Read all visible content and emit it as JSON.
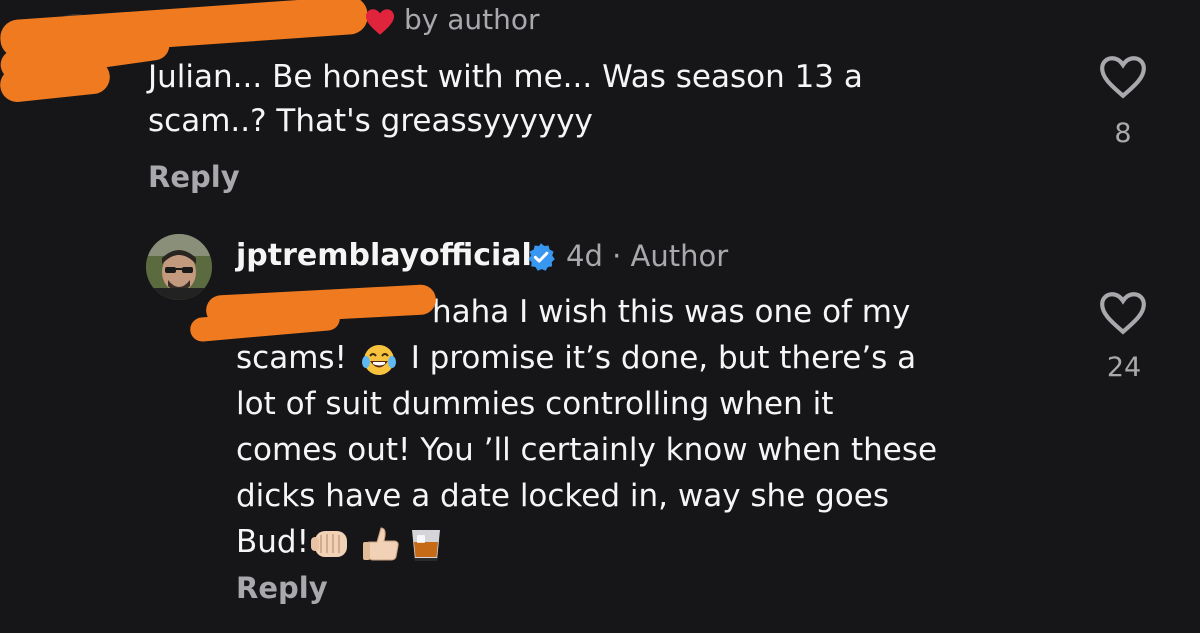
{
  "top_comment": {
    "liked_by_author_label": "by author",
    "text_line1": "Julian... Be honest with me... Was season 13 a",
    "text_line2": "scam..? That's greassyyyyyy",
    "reply_label": "Reply",
    "like_count": "8"
  },
  "reply_comment": {
    "username": "jptremblayofficial",
    "time": "4d",
    "separator": "·",
    "role": "Author",
    "line1": "haha I wish this was one of my",
    "line2_a": "scams!",
    "line2_b": "I promise it’s done, but there’s a",
    "line3": "lot of suit dummies controlling when it",
    "line4": "comes out! You ’ll certainly know when these",
    "line5": "dicks have a date locked in, way she goes",
    "line6": "Bud!",
    "reply_label": "Reply",
    "like_count": "24"
  },
  "colors": {
    "background": "#161619",
    "text": "#f5f5f5",
    "muted": "#a9a9ad",
    "redaction": "#f07a1f",
    "verified": "#3897f0",
    "heart_red": "#e0243b"
  },
  "icons": {
    "liked_heart": "heart-filled-icon",
    "like_button": "heart-outline-icon",
    "verified": "verified-badge-icon",
    "emojis": [
      "tears-of-joy-emoji",
      "fist-bump-emoji",
      "thumbs-up-emoji",
      "whisky-glass-emoji"
    ]
  }
}
